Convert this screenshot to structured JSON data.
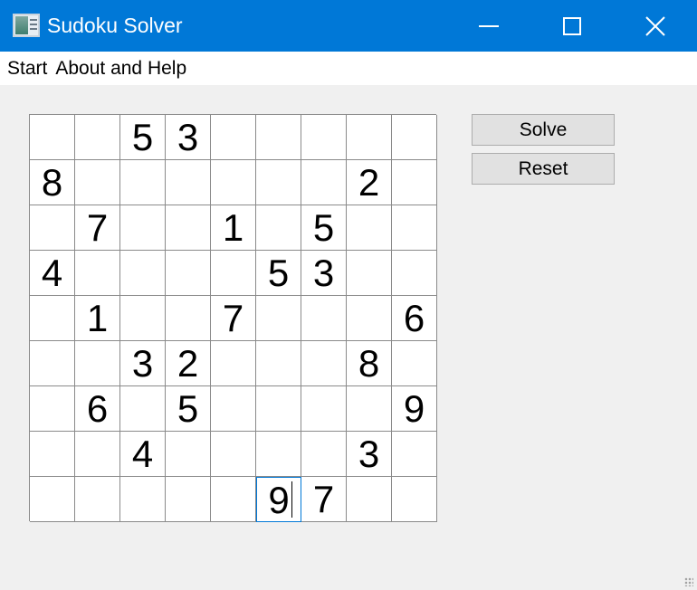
{
  "window": {
    "title": "Sudoku Solver",
    "icons": {
      "app": "sudoku-app-icon",
      "minimize": "minimize-icon",
      "maximize": "maximize-icon",
      "close": "close-icon"
    },
    "accent_color": "#0078d7"
  },
  "menu": {
    "items": [
      "Start",
      "About and Help"
    ]
  },
  "buttons": {
    "solve": "Solve",
    "reset": "Reset"
  },
  "board": {
    "rows": [
      [
        "",
        "",
        "5",
        "3",
        "",
        "",
        "",
        "",
        ""
      ],
      [
        "8",
        "",
        "",
        "",
        "",
        "",
        "",
        "2",
        ""
      ],
      [
        "",
        "7",
        "",
        "",
        "1",
        "",
        "5",
        "",
        ""
      ],
      [
        "4",
        "",
        "",
        "",
        "",
        "5",
        "3",
        "",
        ""
      ],
      [
        "",
        "1",
        "",
        "",
        "7",
        "",
        "",
        "",
        "6"
      ],
      [
        "",
        "",
        "3",
        "2",
        "",
        "",
        "",
        "8",
        ""
      ],
      [
        "",
        "6",
        "",
        "5",
        "",
        "",
        "",
        "",
        "9"
      ],
      [
        "",
        "",
        "4",
        "",
        "",
        "",
        "",
        "3",
        ""
      ],
      [
        "",
        "",
        "",
        "",
        "",
        "9",
        "7",
        "",
        ""
      ]
    ],
    "focused_cell": {
      "row": 8,
      "col": 5
    }
  }
}
